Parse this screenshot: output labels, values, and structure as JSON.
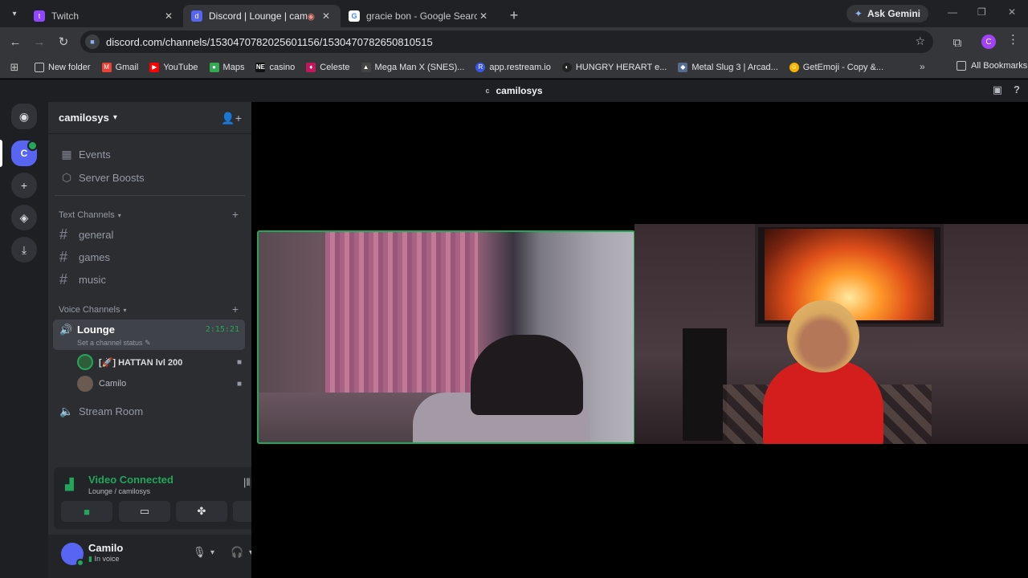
{
  "browser": {
    "tabs": [
      {
        "title": "Twitch",
        "color": "#9146ff",
        "icon": "twitch-icon",
        "glyph": "t"
      },
      {
        "title": "Discord | Lounge | camilosys",
        "color": "#5865f2",
        "icon": "discord-icon",
        "glyph": "d",
        "active": true
      },
      {
        "title": "gracie bon - Google Search",
        "color": "#4285f4",
        "icon": "google-icon",
        "glyph": "G"
      }
    ],
    "ask_gemini": "Ask Gemini",
    "url": "discord.com/channels/1530470782025601156/1530470782650810515",
    "profile_initial": "C",
    "bookmarks": [
      {
        "label": "New folder",
        "icon": "folder-icon",
        "color": "transparent"
      },
      {
        "label": "Gmail",
        "icon": "gmail-icon",
        "color": "#ea4335"
      },
      {
        "label": "YouTube",
        "icon": "youtube-icon",
        "color": "#ff0000"
      },
      {
        "label": "Maps",
        "icon": "maps-icon",
        "color": "#34a853"
      },
      {
        "label": "casino",
        "icon": "ne-icon",
        "color": "#111111"
      },
      {
        "label": "Celeste",
        "icon": "celeste-icon",
        "color": "#c2185b"
      },
      {
        "label": "Mega Man X (SNES)...",
        "icon": "megaman-icon",
        "color": "#444444"
      },
      {
        "label": "app.restream.io",
        "icon": "restream-icon",
        "color": "#3a57e8"
      },
      {
        "label": "HUNGRY HERART e...",
        "icon": "hungry-icon",
        "color": "#222222"
      },
      {
        "label": "Metal Slug 3 | Arcad...",
        "icon": "metalslug-icon",
        "color": "#556b8f"
      },
      {
        "label": "GetEmoji - Copy &...",
        "icon": "emoji-icon",
        "color": "#f4b400"
      }
    ],
    "all_bookmarks": "All Bookmarks"
  },
  "discord": {
    "title_initial": "c",
    "title": "camilosys",
    "server_initial": "C",
    "server_name": "camilosys",
    "menu_items": [
      {
        "label": "Events",
        "icon": "calendar-icon"
      },
      {
        "label": "Server Boosts",
        "icon": "boost-icon"
      }
    ],
    "text_category": "Text Channels",
    "text_channels": [
      "general",
      "games",
      "music"
    ],
    "voice_category": "Voice Channels",
    "lounge": {
      "name": "Lounge",
      "timer": "2:15:21",
      "status": "Set a channel status"
    },
    "voice_users": [
      {
        "name": "[🚀] HATTAN lvl 200",
        "avatar_color": "#2f5d3a"
      },
      {
        "name": "Camilo",
        "avatar_color": "#6b5a50"
      }
    ],
    "stream_room": "Stream Room",
    "voice_panel": {
      "status": "Video Connected",
      "location": "Lounge / camilosys"
    },
    "user": {
      "name": "Camilo",
      "status": "In voice"
    },
    "colors": {
      "green": "#23a55a",
      "blurple": "#5865f2"
    }
  }
}
